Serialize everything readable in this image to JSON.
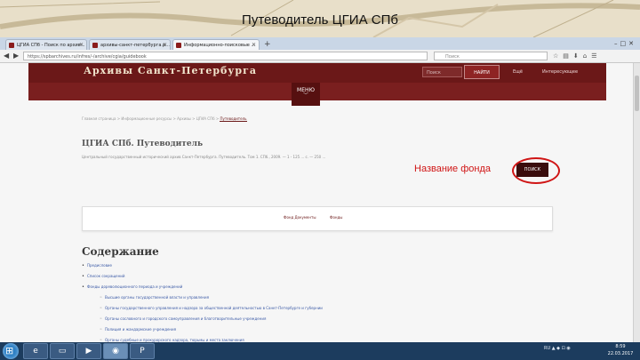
{
  "slide_title": "Путеводитель ЦГИА СПб",
  "browser": {
    "tabs": [
      {
        "label": "ЦГИА СПб - Поиск по архив...",
        "active": false
      },
      {
        "label": "архивы-санкт-петербурга.р...",
        "active": false
      },
      {
        "label": "Информационно-поисковые ...",
        "active": true
      }
    ],
    "new_tab": "+",
    "url": "https://spbarchives.ru/infres/-/archive/cgia/guidebook",
    "search_placeholder": "Поиск"
  },
  "site": {
    "logo": "Архивы Санкт-Петербурга",
    "search_placeholder": "Поиск",
    "search_button": "НАЙТИ",
    "links": [
      "Ещё",
      "Интересующее"
    ],
    "menu_label": "МЕНЮ",
    "menu_chevron": "﹀"
  },
  "breadcrumb": {
    "path": "Главная страница > Информационные ресурсы > Архивы > ЦГИА СПб >",
    "current": "Путеводитель"
  },
  "page": {
    "title": "ЦГИА СПб. Путеводитель",
    "subtitle": "Центральный государственный исторический архив Санкт-Петербурга. Путеводитель. Том 1. СПб., 2009. — 1 - 125 ... с. — 250 ..."
  },
  "annotation": {
    "label": "Название фонда",
    "color": "#d01515"
  },
  "poisk_button": "ПОИСК",
  "panel": {
    "left": "Фонд Документы",
    "right": "Фонды"
  },
  "toc": {
    "title": "Содержание",
    "items": [
      {
        "level": 1,
        "text": "Предисловие"
      },
      {
        "level": 1,
        "text": "Список сокращений"
      },
      {
        "level": 1,
        "text": "Фонды дореволюционного периода и учреждений"
      },
      {
        "level": 2,
        "text": "Высшие органы государственной власти и управления"
      },
      {
        "level": 2,
        "text": "Органы государственного управления и надзора за общественной деятельностью в Санкт-Петербурге и губернии"
      },
      {
        "level": 2,
        "text": "Органы сословного и городского самоуправления и благотворительные учреждения"
      },
      {
        "level": 2,
        "text": "Полиция и жандармские учреждения"
      },
      {
        "level": 2,
        "text": "Органы судебные и прокурорского надзора, тюрьмы и места заключения"
      }
    ]
  },
  "taskbar": {
    "tray": "RU ▲ ◆ ⊡ ◉",
    "time": "8:59",
    "date": "22.03.2017"
  }
}
